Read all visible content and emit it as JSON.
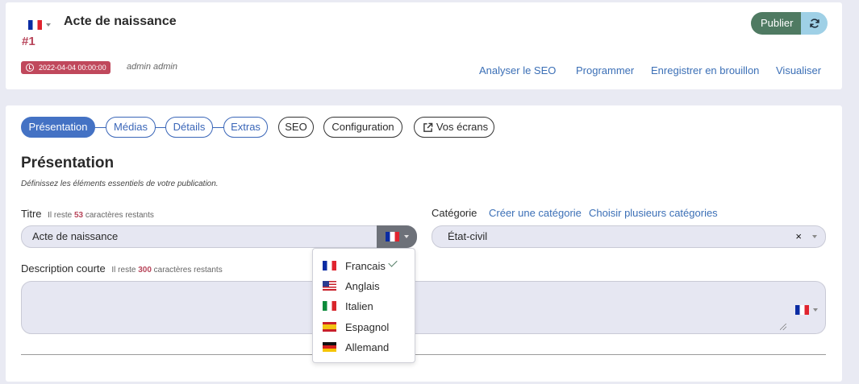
{
  "header": {
    "current_language_flag": "flag-fr",
    "title": "Acte de naissance",
    "id": "#1",
    "date": "2022-04-04 00:00:00",
    "author": "admin admin",
    "publish_label": "Publier",
    "actions": [
      "Analyser le SEO",
      "Programmer",
      "Enregistrer en brouillon",
      "Visualiser"
    ]
  },
  "tabs": [
    "Présentation",
    "Médias",
    "Détails",
    "Extras",
    "SEO",
    "Configuration",
    "Vos écrans"
  ],
  "section": {
    "title": "Présentation",
    "subtitle": "Définissez les éléments essentiels de votre publication."
  },
  "title_field": {
    "label": "Titre",
    "hint_prefix": "Il reste",
    "remaining": "53",
    "hint_suffix": "caractères restants",
    "value": "Acte de naissance"
  },
  "category_field": {
    "label": "Catégorie",
    "create_link": "Créer une catégorie",
    "multi_link": "Choisir plusieurs catégories",
    "value": "État-civil",
    "clear": "×"
  },
  "description_field": {
    "label": "Description courte",
    "hint_prefix": "Il reste",
    "remaining": "300",
    "hint_suffix": "caractères restants",
    "value": ""
  },
  "language_menu": {
    "items": [
      "Francais",
      "Anglais",
      "Italien",
      "Espagnol",
      "Allemand"
    ],
    "selected": "Francais"
  },
  "colors": {
    "accent": "#4472c4",
    "publish": "#4f7a62",
    "refresh": "#9fd0e6",
    "danger": "#c0485c",
    "link": "#3b6fb6"
  }
}
